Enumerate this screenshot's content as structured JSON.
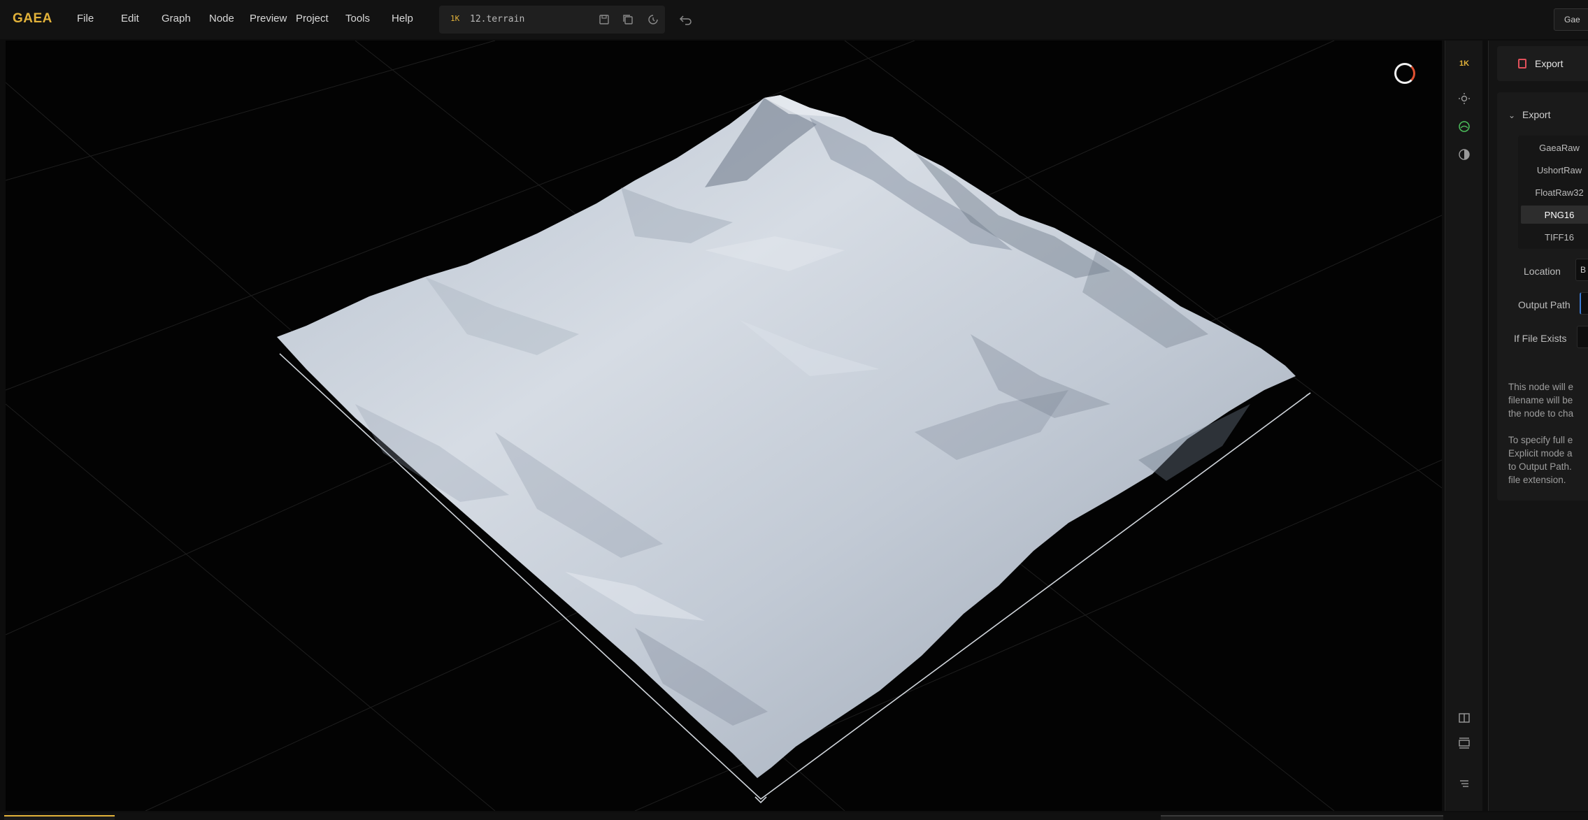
{
  "app": {
    "logo": "GAEA",
    "menu": [
      "File",
      "Edit",
      "Graph",
      "Node",
      "Preview",
      "Project",
      "Tools",
      "Help"
    ],
    "file": {
      "resolution": "1K",
      "name": "12.terrain"
    },
    "corner_button": "Gae"
  },
  "viewport": {
    "description_icon": "loading-spinner"
  },
  "toolstrip": {
    "resolution": "1K"
  },
  "panel": {
    "node_title": "Export",
    "section_title": "Export",
    "formats": [
      "GaeaRaw",
      "UshortRaw",
      "FloatRaw32",
      "PNG16",
      "TIFF16"
    ],
    "selected_format": "PNG16",
    "location_label": "Location",
    "location_value": "B",
    "output_path_label": "Output Path",
    "if_file_exists_label": "If File Exists",
    "description_lines_1": [
      "This node will e",
      "filename will be",
      "the node to cha"
    ],
    "description_lines_2": [
      "To specify full e",
      "Explicit mode a",
      "to Output Path.",
      "file extension."
    ]
  },
  "colors": {
    "accent": "#e2b23a",
    "background": "#0d0d0d",
    "terrain": "#c9d0da",
    "export_icon": "#e0505a"
  }
}
